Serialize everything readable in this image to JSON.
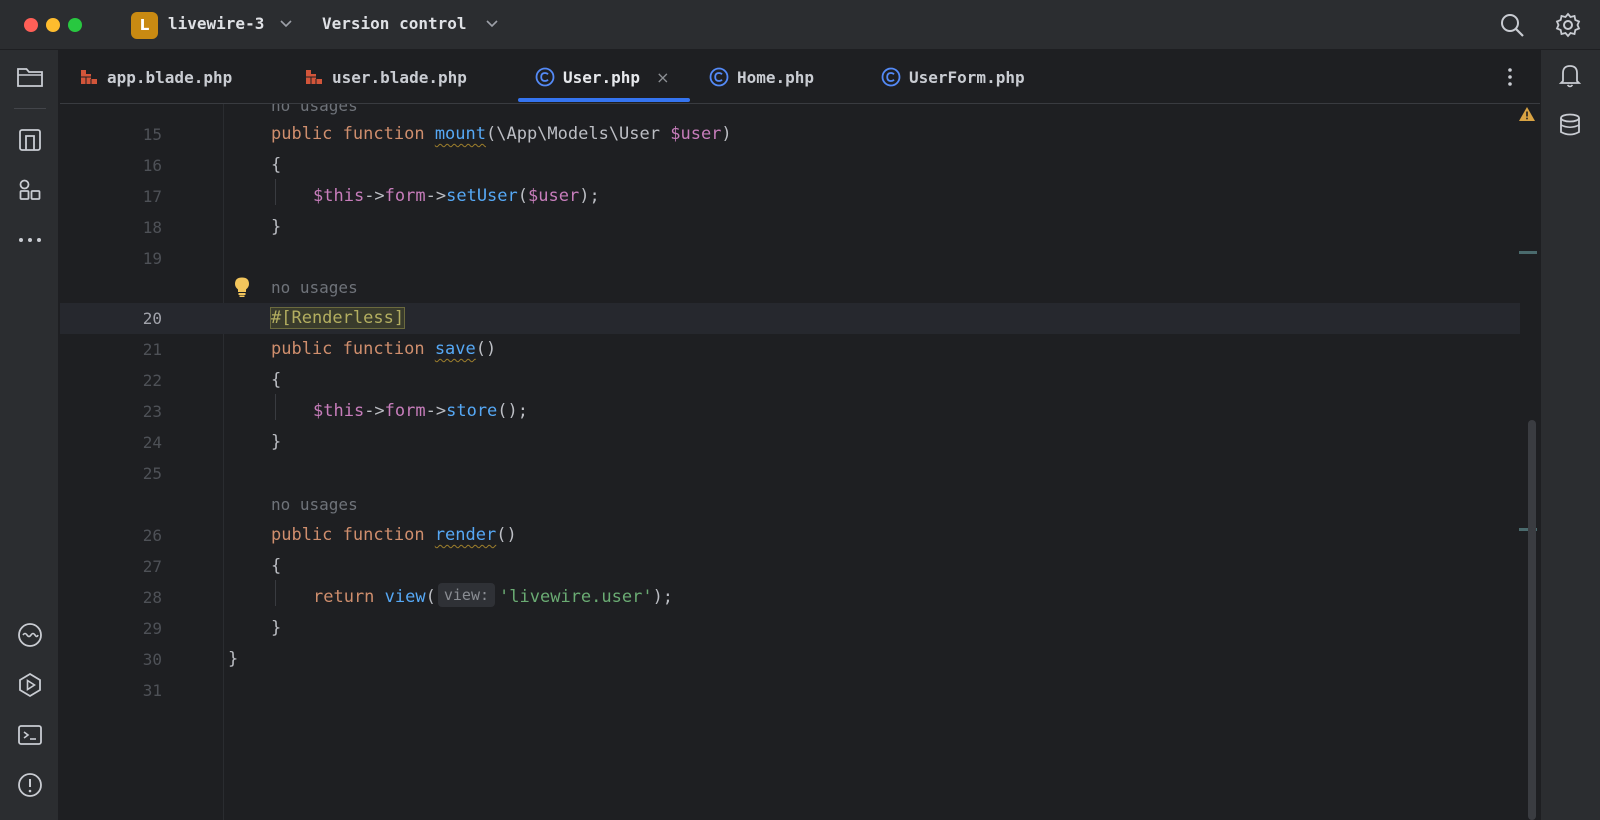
{
  "titlebar": {
    "project_initial": "L",
    "project_name": "livewire-3",
    "vcs_label": "Version control"
  },
  "tabs": [
    {
      "label": "app.blade.php",
      "icon": "blade-icon",
      "active": false
    },
    {
      "label": "user.blade.php",
      "icon": "blade-icon",
      "active": false
    },
    {
      "label": "User.php",
      "icon": "php-class-icon",
      "active": true,
      "close": "×"
    },
    {
      "label": "Home.php",
      "icon": "php-class-icon",
      "active": false
    },
    {
      "label": "UserForm.php",
      "icon": "php-class-icon",
      "active": false
    }
  ],
  "editor": {
    "hints": {
      "top": "no usages",
      "save": "no usages",
      "render": "no usages"
    },
    "line_numbers": [
      "15",
      "16",
      "17",
      "18",
      "19",
      "20",
      "21",
      "22",
      "23",
      "24",
      "25",
      "26",
      "27",
      "28",
      "29",
      "30",
      "31"
    ],
    "current_line": "20",
    "code": {
      "l15_kw1": "public",
      "l15_kw2": "function",
      "l15_fn": "mount",
      "l15_rest1": "(\\App\\Models\\User ",
      "l15_var": "$user",
      "l15_rest2": ")",
      "l16": "{",
      "l17_var1": "$this",
      "l17_arrow1": "->",
      "l17_prop": "form",
      "l17_arrow2": "->",
      "l17_fn": "setUser",
      "l17_p1": "(",
      "l17_var2": "$user",
      "l17_p2": ");",
      "l18": "}",
      "l20_attr": "#[Renderless]",
      "l21_kw1": "public",
      "l21_kw2": "function",
      "l21_fn": "save",
      "l21_rest": "()",
      "l22": "{",
      "l23_var": "$this",
      "l23_arrow1": "->",
      "l23_prop": "form",
      "l23_arrow2": "->",
      "l23_fn": "store",
      "l23_rest": "();",
      "l24": "}",
      "l26_kw1": "public",
      "l26_kw2": "function",
      "l26_fn": "render",
      "l26_rest": "()",
      "l27": "{",
      "l28_kw": "return",
      "l28_fn": "view",
      "l28_p1": "(",
      "l28_hint": "view:",
      "l28_str": "'livewire.user'",
      "l28_p2": ");",
      "l29": "}",
      "l30": "}"
    }
  },
  "colors": {
    "keyword": "#cf8e6d",
    "function": "#56a8f5",
    "variable": "#c77dbb",
    "string": "#6aab73",
    "attribute": "#b3ae60",
    "accent": "#3574f0"
  }
}
